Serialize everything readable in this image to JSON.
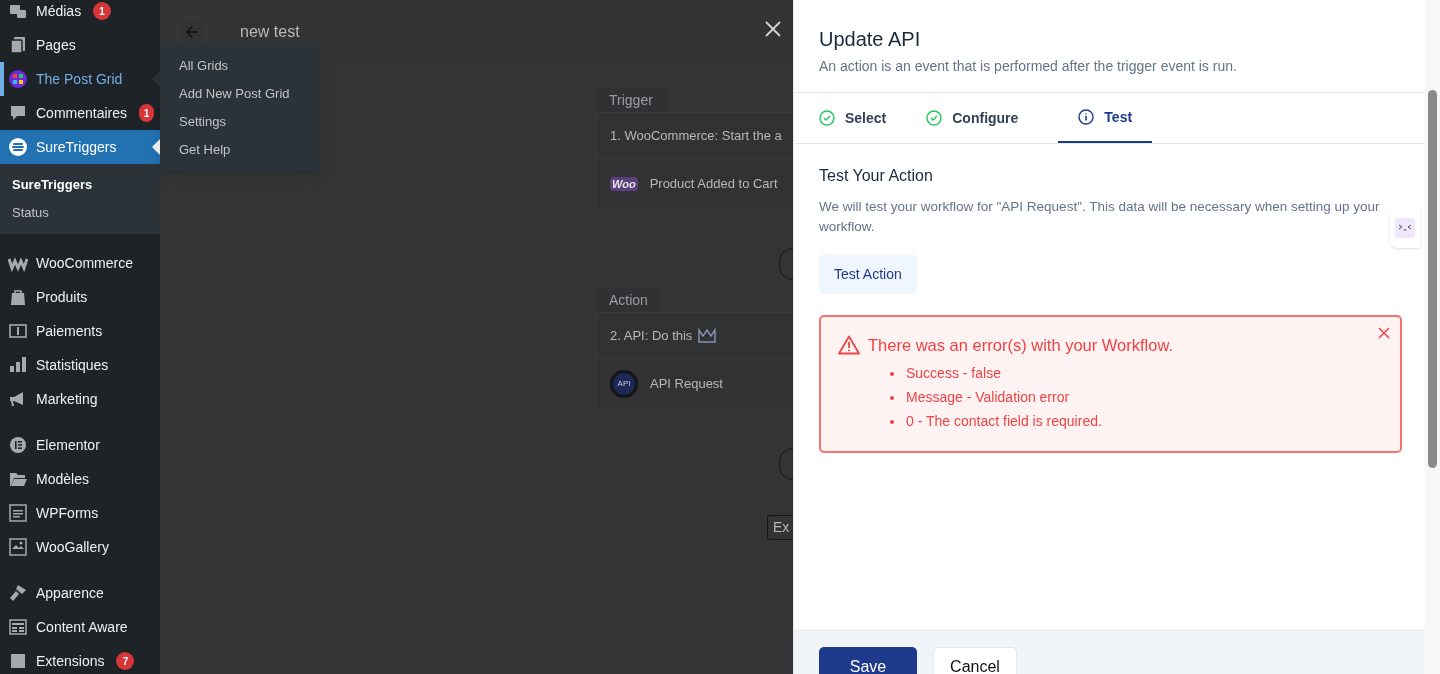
{
  "sidebar": {
    "groups": [
      {
        "items": [
          {
            "label": "Médias",
            "badge": "1",
            "selected": false,
            "hovered": false
          },
          {
            "label": "Pages",
            "selected": false,
            "hovered": false
          },
          {
            "label": "The Post Grid",
            "selected": false,
            "hovered": true,
            "flyout": [
              "All Grids",
              "Add New Post Grid",
              "Settings",
              "Get Help"
            ]
          },
          {
            "label": "Commentaires",
            "badge": "1",
            "selected": false,
            "hovered": false
          },
          {
            "label": "SureTriggers",
            "selected": true,
            "hovered": false,
            "submenu": [
              {
                "label": "SureTriggers",
                "selected": true
              },
              {
                "label": "Status",
                "selected": false
              }
            ]
          }
        ]
      },
      {
        "items": [
          {
            "label": "WooCommerce",
            "selected": false,
            "hovered": false
          },
          {
            "label": "Produits",
            "selected": false,
            "hovered": false
          },
          {
            "label": "Paiements",
            "selected": false,
            "hovered": false
          },
          {
            "label": "Statistiques",
            "selected": false,
            "hovered": false
          },
          {
            "label": "Marketing",
            "selected": false,
            "hovered": false
          }
        ]
      },
      {
        "items": [
          {
            "label": "Elementor",
            "selected": false,
            "hovered": false
          },
          {
            "label": "Modèles",
            "selected": false,
            "hovered": false
          },
          {
            "label": "WPForms",
            "selected": false,
            "hovered": false
          },
          {
            "label": "WooGallery",
            "selected": false,
            "hovered": false
          }
        ]
      },
      {
        "items": [
          {
            "label": "Apparence",
            "selected": false,
            "hovered": false
          },
          {
            "label": "Content Aware",
            "selected": false,
            "hovered": false
          },
          {
            "label": "Extensions",
            "badge": "7",
            "selected": false,
            "hovered": false
          }
        ]
      }
    ]
  },
  "workflow": {
    "title": "new test",
    "sections": [
      {
        "label": "Trigger",
        "step": "1. WooCommerce: Start the a",
        "premium": false,
        "app": "Product Added to Cart",
        "kind": "woo",
        "logo": "Woo"
      },
      {
        "label": "Action",
        "step": "2. API: Do this",
        "premium": true,
        "app": "API Request",
        "kind": "api",
        "logo": "API"
      }
    ],
    "extra_button": "Ex"
  },
  "panel": {
    "title": "Update API",
    "subtitle": "An action is an event that is performed after the trigger event is run.",
    "tabs": [
      {
        "label": "Select",
        "done": true,
        "selected": false
      },
      {
        "label": "Configure",
        "done": true,
        "selected": false
      },
      {
        "label": "Test",
        "done": false,
        "selected": true
      }
    ],
    "section_title": "Test Your Action",
    "description": "We will test your workflow for \"API Request\". This data will be necessary when setting up your workflow.",
    "test_button": "Test Action",
    "error": {
      "title": "There was an error(s) with your Workflow.",
      "items": [
        "Success - false",
        "Message - Validation error",
        "0 - The contact field is required."
      ]
    },
    "buttons": [
      "Save",
      "Cancel"
    ]
  }
}
